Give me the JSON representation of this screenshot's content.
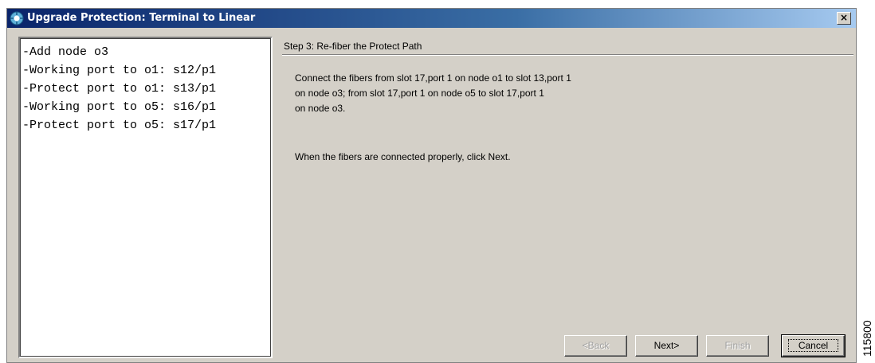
{
  "window": {
    "title": "Upgrade Protection: Terminal to Linear",
    "close_label": "×"
  },
  "summary": {
    "items": [
      "-Add node o3",
      "-Working port to o1: s12/p1",
      "-Protect port to o1: s13/p1",
      "-Working port to o5: s16/p1",
      "-Protect port to o5: s17/p1"
    ]
  },
  "step": {
    "title": "Step 3: Re-fiber the Protect Path",
    "lines": [
      "Connect the fibers from slot 17,port 1 on node o1 to slot 13,port 1",
      "on node o3; from slot 17,port 1 on node o5 to slot 17,port 1",
      "on node o3."
    ],
    "hint": "When the fibers are connected properly, click Next."
  },
  "buttons": {
    "back": "<Back",
    "next": "Next>",
    "finish": "Finish",
    "cancel": "Cancel"
  },
  "figure_id": "115800"
}
